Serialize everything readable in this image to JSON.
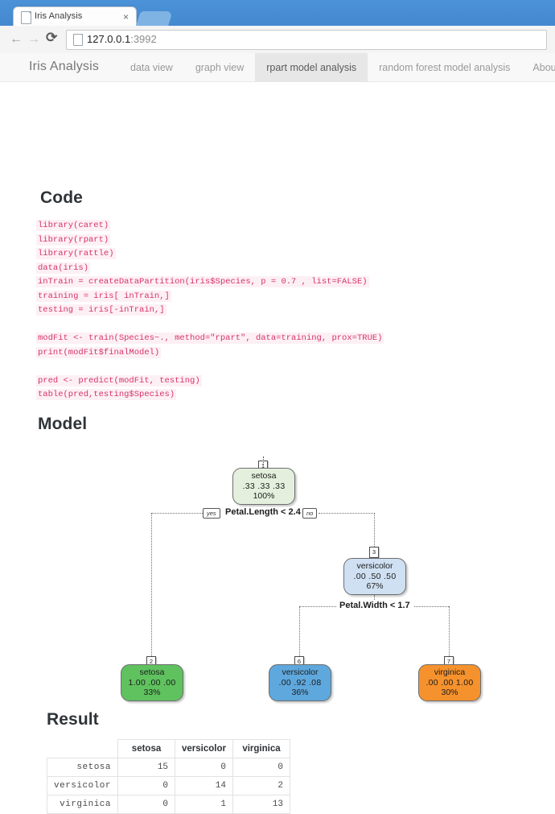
{
  "browser": {
    "tab_title": "Iris Analysis",
    "tab_close": "×",
    "back_icon": "←",
    "forward_icon": "→",
    "reload_icon": "⟳",
    "url_host": "127.0.0.1",
    "url_port": ":3992"
  },
  "navbar": {
    "brand": "Iris Analysis",
    "items": [
      {
        "label": "data view",
        "active": false
      },
      {
        "label": "graph view",
        "active": false
      },
      {
        "label": "rpart model analysis",
        "active": true
      },
      {
        "label": "random forest model analysis",
        "active": false
      },
      {
        "label": "About",
        "active": false
      }
    ]
  },
  "sections": {
    "code_title": "Code",
    "model_title": "Model",
    "result_title": "Result"
  },
  "code": {
    "lines": [
      "library(caret)",
      "library(rpart)",
      "library(rattle)",
      "data(iris)",
      "inTrain = createDataPartition(iris$Species, p = 0.7 , list=FALSE)",
      "training = iris[ inTrain,]",
      "testing = iris[-inTrain,]",
      "",
      "modFit <- train(Species~., method=\"rpart\", data=training, prox=TRUE)",
      "print(modFit$finalModel)",
      "",
      "pred <- predict(modFit, testing)",
      "table(pred,testing$Species)"
    ]
  },
  "tree": {
    "nodes": [
      {
        "id": "1",
        "label": "setosa",
        "probs": ".33  .33  .33",
        "pct": "100%",
        "fill": "#e4f0dd"
      },
      {
        "id": "3",
        "label": "versicolor",
        "probs": ".00  .50  .50",
        "pct": "67%",
        "fill": "#cfe0f2"
      },
      {
        "id": "2",
        "label": "setosa",
        "probs": "1.00  .00  .00",
        "pct": "33%",
        "fill": "#5fc25f"
      },
      {
        "id": "6",
        "label": "versicolor",
        "probs": ".00  .92  .08",
        "pct": "36%",
        "fill": "#5fa8dd"
      },
      {
        "id": "7",
        "label": "virginica",
        "probs": ".00  .00  1.00",
        "pct": "30%",
        "fill": "#f6922d"
      }
    ],
    "splits": [
      {
        "text": "Petal.Length < 2.4",
        "yes": "yes",
        "no": "no"
      },
      {
        "text": "Petal.Width < 1.7"
      }
    ]
  },
  "result": {
    "columns": [
      "",
      "setosa",
      "versicolor",
      "virginica"
    ],
    "rows": [
      {
        "name": "setosa",
        "values": [
          "15",
          "0",
          "0"
        ]
      },
      {
        "name": "versicolor",
        "values": [
          "0",
          "14",
          "2"
        ]
      },
      {
        "name": "virginica",
        "values": [
          "0",
          "1",
          "13"
        ]
      }
    ]
  }
}
